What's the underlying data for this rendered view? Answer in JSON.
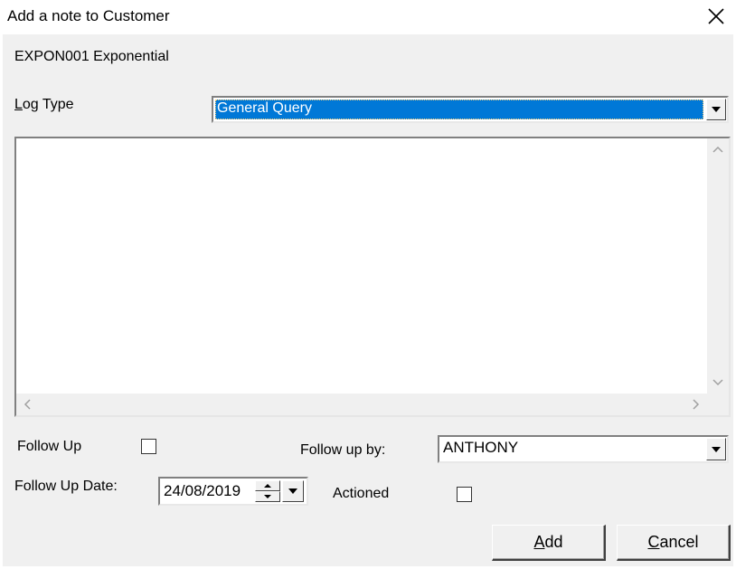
{
  "window": {
    "title": "Add a note to Customer",
    "close_icon": "close-icon"
  },
  "customer": {
    "code_name": "EXPON001 Exponential"
  },
  "log_type": {
    "label_prefix": "L",
    "label_rest": "og Type",
    "selected": "General Query"
  },
  "note": {
    "value": ""
  },
  "follow_up": {
    "label": "Follow Up",
    "checked": false
  },
  "follow_up_by": {
    "label": "Follow up by:",
    "selected": "ANTHONY"
  },
  "follow_up_date": {
    "label": "Follow Up Date:",
    "value": "24/08/2019"
  },
  "actioned": {
    "label": "Actioned",
    "checked": false
  },
  "buttons": {
    "add_prefix": "A",
    "add_rest": "dd",
    "cancel_prefix": "C",
    "cancel_rest": "ancel"
  },
  "colors": {
    "selection": "#0078d7",
    "dialog_bg": "#f0f0f0"
  }
}
